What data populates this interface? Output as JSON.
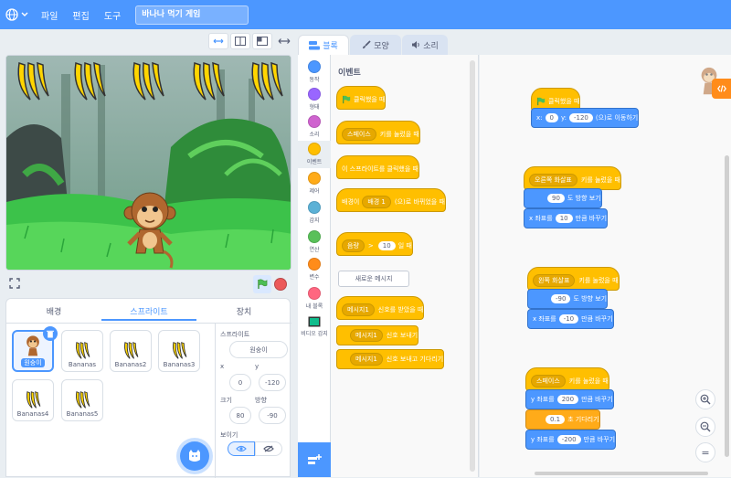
{
  "menubar": {
    "file": "파일",
    "edit": "편집",
    "tutorials": "도구",
    "project_title": "바나나 먹기 게임"
  },
  "editor_tabs": {
    "code": "블록",
    "costumes": "모양",
    "sounds": "소리"
  },
  "categories": [
    {
      "label": "동작",
      "color": "#4c97ff"
    },
    {
      "label": "형태",
      "color": "#9966ff"
    },
    {
      "label": "소리",
      "color": "#cf63cf"
    },
    {
      "label": "이벤트",
      "color": "#ffbf00"
    },
    {
      "label": "제어",
      "color": "#ffab19"
    },
    {
      "label": "감지",
      "color": "#5cb1d6"
    },
    {
      "label": "연산",
      "color": "#59c059"
    },
    {
      "label": "변수",
      "color": "#ff8c1a"
    },
    {
      "label": "내 블록",
      "color": "#ff6680"
    },
    {
      "label": "비디오 감지",
      "color": "#0fbd8c"
    }
  ],
  "palette": {
    "heading": "이벤트",
    "when_flag": "클릭했을 때",
    "when_key_dd": "스페이스",
    "when_key_text": "키를 눌렀을 때",
    "when_sprite_clicked": "이 스프라이트를 클릭했을 때",
    "backdrop_prefix": "배경이",
    "backdrop_dd": "배경 1",
    "backdrop_suffix": "(으)로 바뀌었을 때",
    "loud_dd": "음량",
    "loud_val": "10",
    "loud_suffix": "일 때",
    "new_message": "새로운 메시지",
    "msg_dd": "메시지1",
    "receive_suffix": "신호를 받았을 때",
    "broadcast_suffix": "신호 보내기",
    "broadcast_wait_suffix": "신호 보내고 기다리기"
  },
  "scripts": {
    "s1_hat": "클릭했을 때",
    "s1_x_prefix": "x:",
    "s1_x": "0",
    "s1_y_prefix": "y:",
    "s1_y": "-120",
    "s1_goto_suffix": "(으)로 이동하기",
    "s2_dd": "오른쪽 화살표",
    "s2_hat_suffix": "키를 눌렀을 때",
    "s2_dir": "90",
    "s2_dir_suffix": "도 방향 보기",
    "s2_change_prefix": "x 좌표를",
    "s2_change": "10",
    "s2_change_suffix": "만큼 바꾸기",
    "s3_dd": "왼쪽 화살표",
    "s3_hat_suffix": "키를 눌렀을 때",
    "s3_dir": "-90",
    "s3_dir_suffix": "도 방향 보기",
    "s3_change_prefix": "x 좌표를",
    "s3_change": "-10",
    "s3_change_suffix": "만큼 바꾸기",
    "s4_dd": "스페이스",
    "s4_hat_suffix": "키를 눌렀을 때",
    "s4_y1_prefix": "y 좌표를",
    "s4_y1": "200",
    "s4_y1_suffix": "만큼 바꾸기",
    "s4_wait": "0.1",
    "s4_wait_suffix": "초 기다리기",
    "s4_y2_prefix": "y 좌표를",
    "s4_y2": "-200",
    "s4_y2_suffix": "만큼 바꾸기"
  },
  "target_tabs": {
    "backdrop": "배경",
    "sprite": "스프라이트",
    "sound": "장치"
  },
  "sprites": [
    {
      "name": "원숭이",
      "selected": true
    },
    {
      "name": "Bananas"
    },
    {
      "name": "Bananas2"
    },
    {
      "name": "Bananas3"
    },
    {
      "name": "Bananas4"
    },
    {
      "name": "Bananas5"
    }
  ],
  "sprite_info": {
    "label": "스프라이트",
    "name": "원숭이",
    "x_label": "x",
    "x": "0",
    "y_label": "y",
    "y": "-120",
    "size_label": "크기",
    "size": "80",
    "direction_label": "방향",
    "direction": "-90",
    "show_label": "보이기"
  },
  "zoom": {
    "reset": "="
  }
}
